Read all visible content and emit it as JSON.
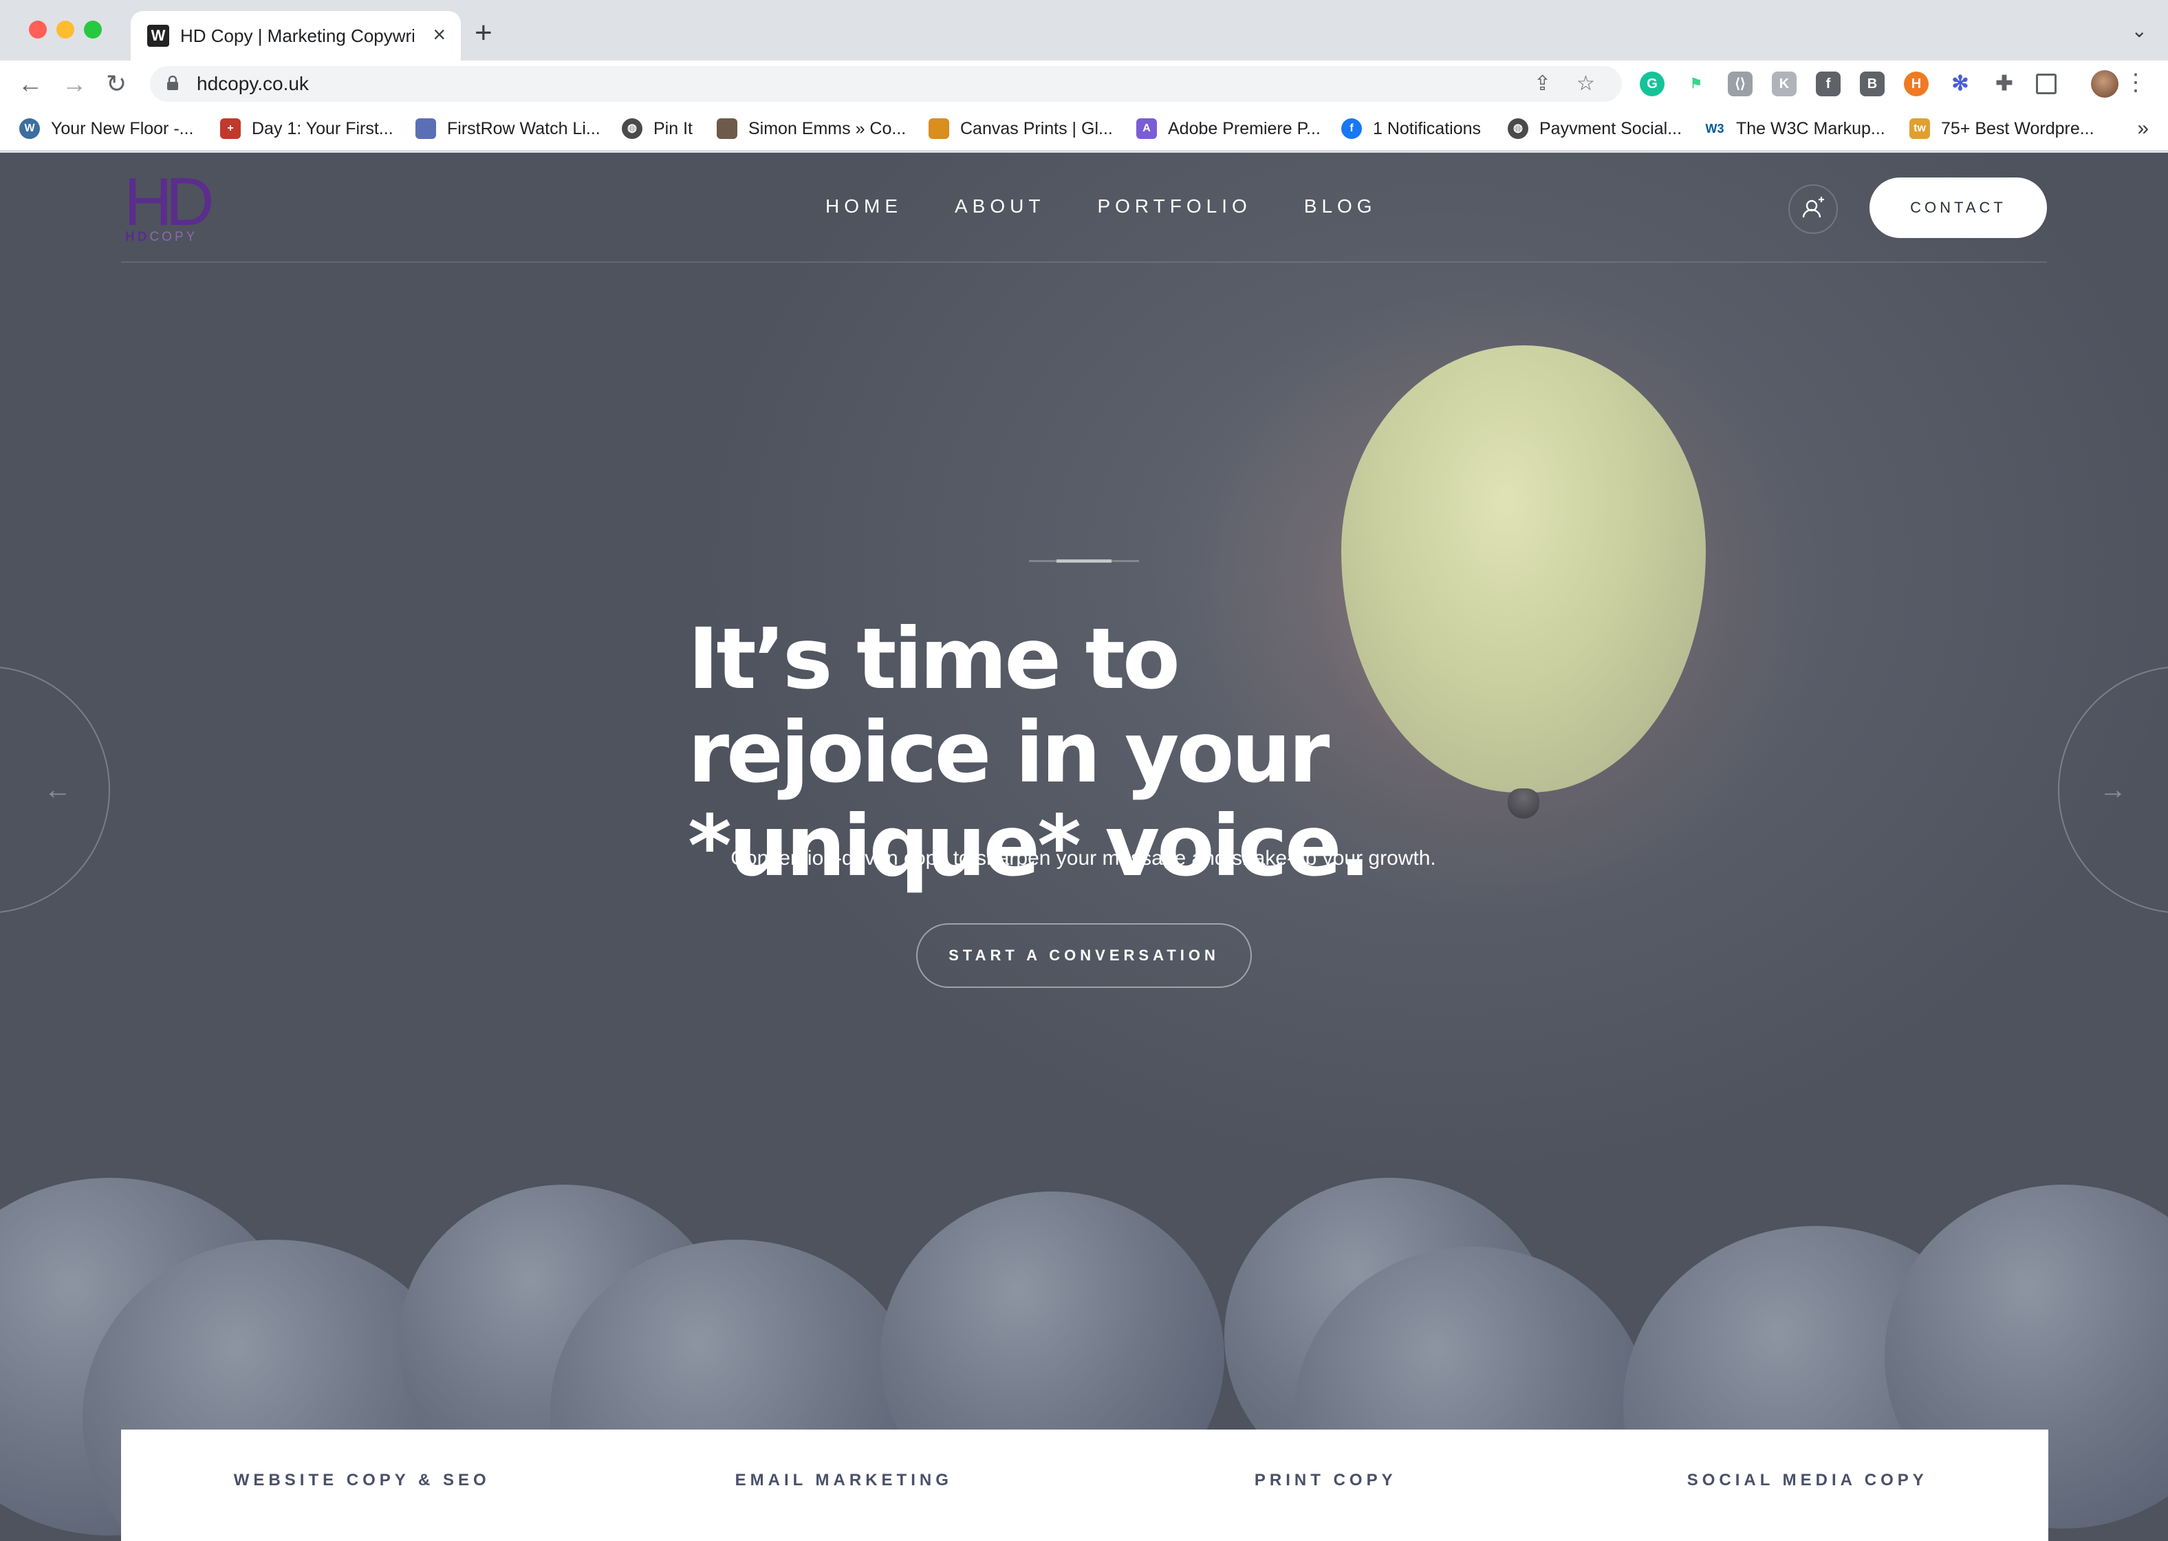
{
  "browser": {
    "tab_title": "HD Copy | Marketing Copywriter",
    "tab_favicon": "W",
    "new_tab_icon": "+",
    "url": "hdcopy.co.uk",
    "bookmarks": [
      {
        "label": "Your New Floor -...",
        "icon": "wordpress-icon",
        "color": "#3c6e9e"
      },
      {
        "label": "Day 1: Your First...",
        "icon": "bookmark-favicon",
        "color": "#c0392b"
      },
      {
        "label": "FirstRow Watch Li...",
        "icon": "bookmark-favicon",
        "color": "#5b6fb6"
      },
      {
        "label": "Pin It",
        "icon": "globe-icon",
        "color": "#4a4a4a"
      },
      {
        "label": "Simon Emms » Co...",
        "icon": "bookmark-favicon",
        "color": "#6e5a4a"
      },
      {
        "label": "Canvas Prints | Gl...",
        "icon": "bookmark-favicon",
        "color": "#d98e1e"
      },
      {
        "label": "Adobe Premiere P...",
        "icon": "bookmark-favicon",
        "color": "#7b5cd6"
      },
      {
        "label": "1 Notifications",
        "icon": "facebook-icon",
        "color": "#1877f2"
      },
      {
        "label": "Payvment Social...",
        "icon": "globe-icon",
        "color": "#4a4a4a"
      },
      {
        "label": "The W3C Markup...",
        "icon": "w3c-icon",
        "color": "#005a9c"
      },
      {
        "label": "75+ Best Wordpre...",
        "icon": "bookmark-favicon",
        "color": "#e0a030"
      }
    ]
  },
  "site": {
    "logo_mark": "HD",
    "logo_sub_bold": "HD",
    "logo_sub_light": "COPY",
    "nav": [
      "HOME",
      "ABOUT",
      "PORTFOLIO",
      "BLOG"
    ],
    "contact_label": "CONTACT",
    "hero_title": "It’s time to rejoice in your *unique* voice.",
    "hero_subtitle": "Conversion-driven copy to sharpen your message and shake-up your growth.",
    "cta_label": "START A CONVERSATION",
    "arrow_prev": "←",
    "arrow_next": "→",
    "services": [
      "WEBSITE COPY & SEO",
      "EMAIL MARKETING",
      "PRINT COPY",
      "SOCIAL MEDIA COPY"
    ]
  },
  "colors": {
    "brand_purple": "#5b2d8c",
    "service_text": "#4a5069"
  }
}
